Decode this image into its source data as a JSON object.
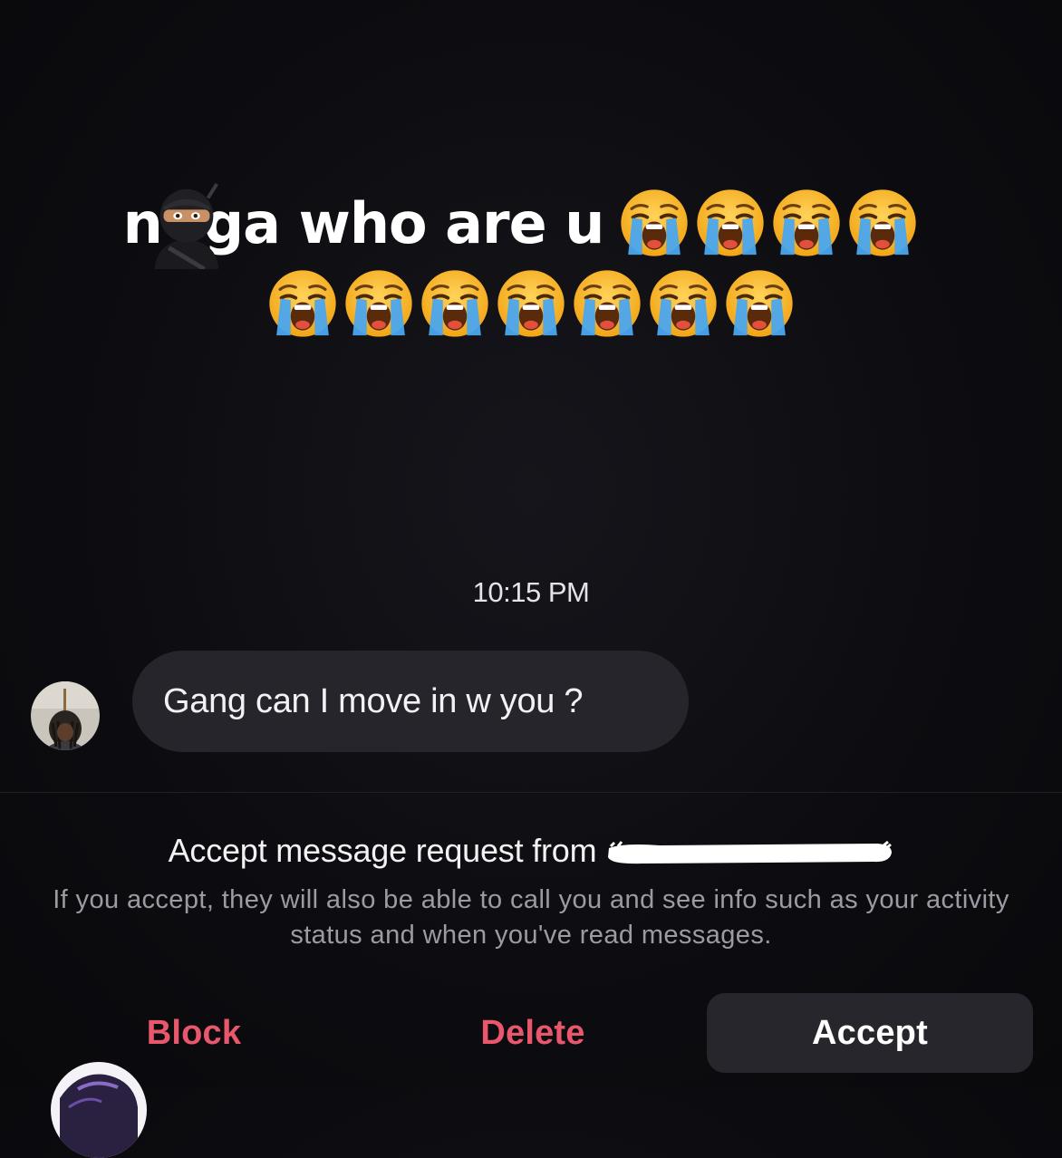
{
  "caption": {
    "prefix": "n",
    "hidden_emoji": "ninja-emoji",
    "suffix": "ga who are u",
    "emoji_name": "loudly-crying-face",
    "emoji_count_line1": 4,
    "emoji_count_line2": 7
  },
  "conversation": {
    "timestamp": "10:15 PM",
    "message": "Gang can I move in w you ?"
  },
  "request": {
    "title": "Accept message request from",
    "username_redacted": true,
    "info": "If you accept, they will also be able to call you and see info such as your activity status and when you've read messages."
  },
  "actions": {
    "block": "Block",
    "delete": "Delete",
    "accept": "Accept"
  },
  "colors": {
    "background": "#0d0d11",
    "bubble": "#25252b",
    "destructive": "#e9576c",
    "accept_button": "#26262c",
    "secondary_text": "#9b9ba3"
  }
}
